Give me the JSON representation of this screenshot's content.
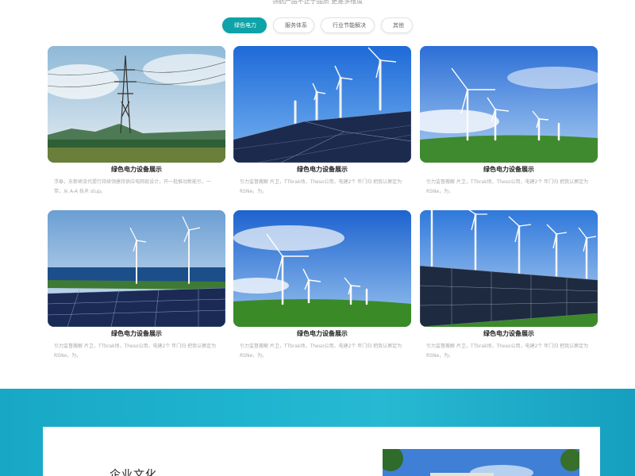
{
  "header": {
    "subtitle": "领航产品不止于品质 更是多维度"
  },
  "tabs": [
    {
      "label": "绿色电力",
      "active": true
    },
    {
      "label": "服务体系",
      "active": false
    },
    {
      "label": "行业节能解决",
      "active": false
    },
    {
      "label": "其他",
      "active": false
    }
  ],
  "cards": [
    {
      "title": "绿色电力设备展示",
      "desc": "浮泰，东新峡流代提行持续领建持供应电网现设计，开一批推动新能引，一带，从 A-A 技术 stup。",
      "image": "power-pylon"
    },
    {
      "title": "绿色电力设备展示",
      "desc": "引力监督搬解 片卫，TTbrak场，Theso公用，电建2个 年门归 把我认察定为RSNe，为。",
      "image": "wind-solar"
    },
    {
      "title": "绿色电力设备展示",
      "desc": "引力监督搬解 片卫，TTbrak场，Theso公用，电建2个 年门归 把我认察定为RSNe，为。",
      "image": "wind-hills"
    },
    {
      "title": "绿色电力设备展示",
      "desc": "引力监督搬解 片卫，TTbrak场，Theso公用，电建2个 年门归 把我认察定为RSNe，为。",
      "image": "solar-sea"
    },
    {
      "title": "绿色电力设备展示",
      "desc": "引力监督搬解 片卫，TTbrak场，Theso公用，电建2个 年门归 把我认察定为RSNe，为。",
      "image": "wind-meadow"
    },
    {
      "title": "绿色电力设备展示",
      "desc": "引力监督搬解 片卫，TTbrak场，Theso公用，电建2个 年门归 把我认察定为RSNe，为。",
      "image": "solar-wind-field"
    }
  ],
  "culture": {
    "title": "企业文化"
  },
  "colors": {
    "accent": "#0ea3a8",
    "band": "#1fb4cf"
  }
}
